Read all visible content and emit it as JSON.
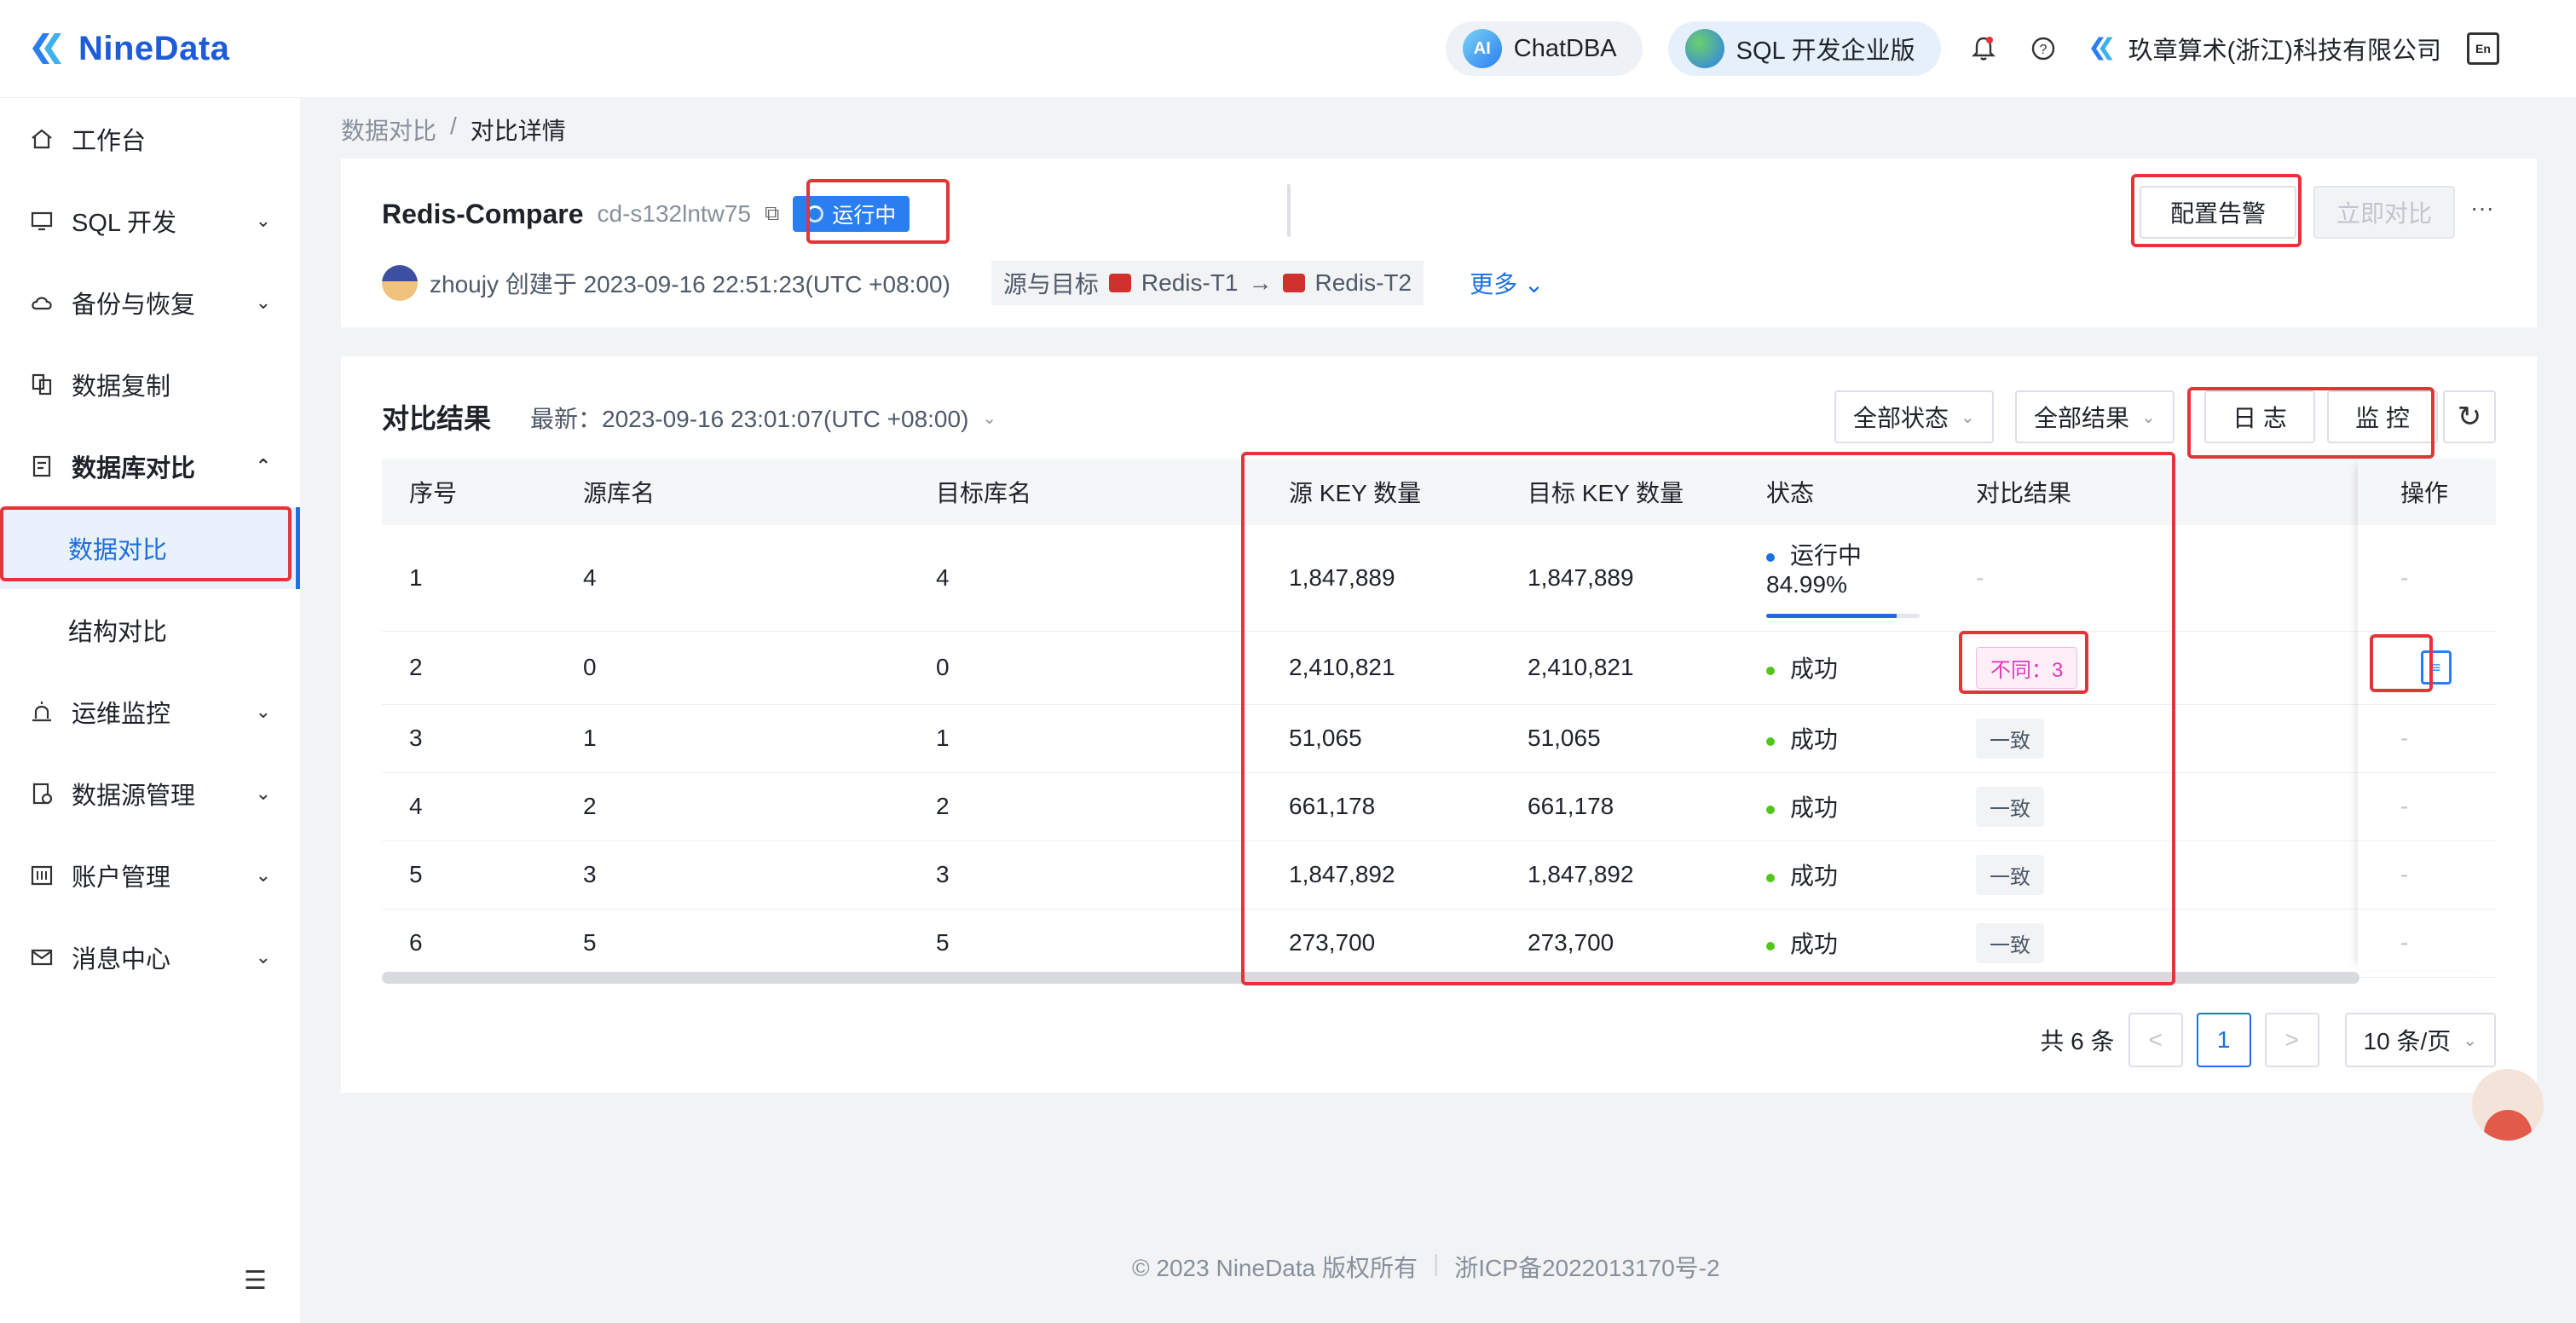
{
  "app": {
    "logo_text": "NineData"
  },
  "topbar": {
    "chatdba_label": "ChatDBA",
    "chatdba_badge": "AI",
    "sql_label": "SQL 开发企业版",
    "company": "玖章算术(浙江)科技有限公司",
    "lang_badge": "En"
  },
  "sidebar": {
    "items": [
      {
        "label": "工作台",
        "icon": "home-icon"
      },
      {
        "label": "SQL 开发",
        "icon": "monitor-icon"
      },
      {
        "label": "备份与恢复",
        "icon": "cloud-icon"
      },
      {
        "label": "数据复制",
        "icon": "copy-data-icon"
      },
      {
        "label": "数据库对比",
        "icon": "compare-icon"
      },
      {
        "label": "数据对比"
      },
      {
        "label": "结构对比"
      },
      {
        "label": "运维监控",
        "icon": "alarm-icon"
      },
      {
        "label": "数据源管理",
        "icon": "datasource-icon"
      },
      {
        "label": "账户管理",
        "icon": "account-icon"
      },
      {
        "label": "消息中心",
        "icon": "mail-icon"
      }
    ]
  },
  "breadcrumb": {
    "parent": "数据对比",
    "separator": "/",
    "current": "对比详情"
  },
  "task": {
    "name": "Redis-Compare",
    "id": "cd-s132lntw75",
    "status": "运行中",
    "creator_line": "zhoujy 创建于 2023-09-16 22:51:23(UTC +08:00)",
    "src_tgt_label": "源与目标",
    "source": "Redis-T1",
    "arrow": "→",
    "target": "Redis-T2",
    "more": "更多"
  },
  "actions": {
    "alert": "配置告警",
    "compare_now": "立即对比",
    "more": "···"
  },
  "results": {
    "title": "对比结果",
    "latest": "最新：2023-09-16 23:01:07(UTC +08:00)",
    "filter_status": "全部状态",
    "filter_result": "全部结果",
    "log": "日 志",
    "monitor": "监 控"
  },
  "table": {
    "columns": [
      "序号",
      "源库名",
      "目标库名",
      "源 KEY 数量",
      "目标 KEY 数量",
      "状态",
      "对比结果",
      "操作"
    ],
    "rows": [
      {
        "no": "1",
        "src_db": "4",
        "tgt_db": "4",
        "src_keys": "1,847,889",
        "tgt_keys": "1,847,889",
        "status": "运行中 84.99%",
        "progress": 0.8499,
        "result": "-",
        "op": "-"
      },
      {
        "no": "2",
        "src_db": "0",
        "tgt_db": "0",
        "src_keys": "2,410,821",
        "tgt_keys": "2,410,821",
        "status": "成功",
        "result": "不同：3",
        "op": "doc-icon"
      },
      {
        "no": "3",
        "src_db": "1",
        "tgt_db": "1",
        "src_keys": "51,065",
        "tgt_keys": "51,065",
        "status": "成功",
        "result": "一致",
        "op": "-"
      },
      {
        "no": "4",
        "src_db": "2",
        "tgt_db": "2",
        "src_keys": "661,178",
        "tgt_keys": "661,178",
        "status": "成功",
        "result": "一致",
        "op": "-"
      },
      {
        "no": "5",
        "src_db": "3",
        "tgt_db": "3",
        "src_keys": "1,847,892",
        "tgt_keys": "1,847,892",
        "status": "成功",
        "result": "一致",
        "op": "-"
      },
      {
        "no": "6",
        "src_db": "5",
        "tgt_db": "5",
        "src_keys": "273,700",
        "tgt_keys": "273,700",
        "status": "成功",
        "result": "一致",
        "op": "-"
      }
    ]
  },
  "pagination": {
    "total": "共 6 条",
    "page": "1",
    "page_size": "10 条/页",
    "prev": "<",
    "next": ">"
  },
  "footer": {
    "copyright": "© 2023 NineData 版权所有",
    "icp": "浙ICP备2022013170号-2"
  },
  "colors": {
    "primary": "#1e6fe0",
    "highlight": "#e5333a",
    "success": "#52c41a",
    "diff": "#e03ab7"
  }
}
